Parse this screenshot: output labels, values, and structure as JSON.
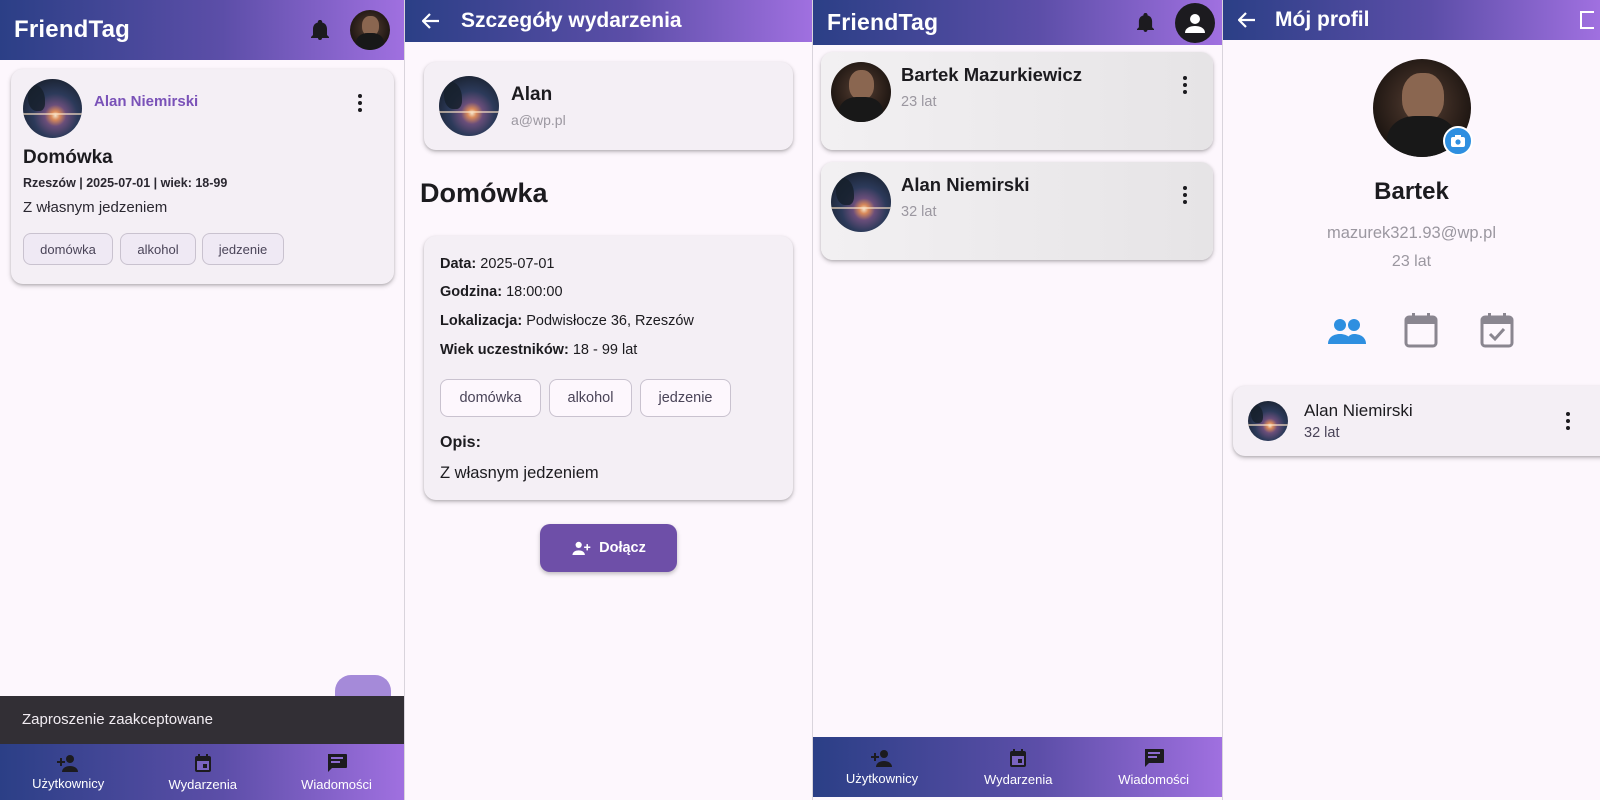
{
  "panel1": {
    "app_title": "FriendTag",
    "event_card": {
      "author": "Alan Niemirski",
      "title": "Domówka",
      "meta": "Rzeszów | 2025-07-01 | wiek: 18-99",
      "description": "Z własnym jedzeniem",
      "tags": [
        "domówka",
        "alkohol",
        "jedzenie"
      ]
    },
    "snackbar": "Zaproszenie zaakceptowane",
    "bottom_nav": [
      "Użytkownicy",
      "Wydarzenia",
      "Wiadomości"
    ]
  },
  "panel2": {
    "title": "Szczegóły wydarzenia",
    "organizer": {
      "name": "Alan",
      "email": "a@wp.pl"
    },
    "event_title": "Domówka",
    "details": {
      "date_label": "Data:",
      "date": "2025-07-01",
      "time_label": "Godzina:",
      "time": "18:00:00",
      "location_label": "Lokalizacja:",
      "location": "Podwisłocze 36, Rzeszów",
      "age_label": "Wiek uczestników:",
      "age": "18 - 99 lat",
      "tags": [
        "domówka",
        "alkohol",
        "jedzenie"
      ],
      "desc_label": "Opis:",
      "description": "Z własnym jedzeniem"
    },
    "join_button": "Dołącz"
  },
  "panel3": {
    "app_title": "FriendTag",
    "users": [
      {
        "name": "Bartek Mazurkiewicz",
        "age": "23 lat"
      },
      {
        "name": "Alan Niemirski",
        "age": "32 lat"
      }
    ],
    "bottom_nav": [
      "Użytkownicy",
      "Wydarzenia",
      "Wiadomości"
    ]
  },
  "panel4": {
    "title": "Mój profil",
    "name": "Bartek",
    "email": "mazurek321.93@wp.pl",
    "age": "23 lat",
    "friend": {
      "name": "Alan Niemirski",
      "age": "32 lat"
    }
  },
  "colors": {
    "brand_gradient_start": "#2b3f86",
    "brand_gradient_end": "#a070e0",
    "accent_purple": "#7a52b8",
    "join_button": "#6e4fa8",
    "profile_blue": "#2e8fe0"
  }
}
